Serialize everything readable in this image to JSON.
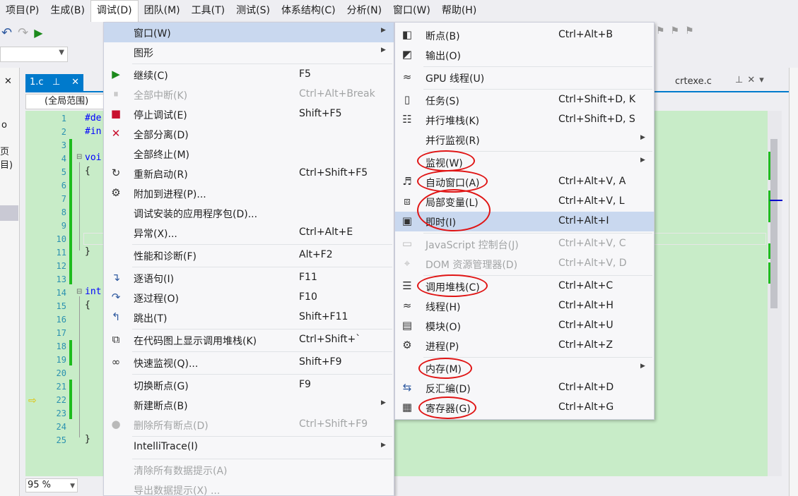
{
  "menubar": [
    "项目(P)",
    "生成(B)",
    "调试(D)",
    "团队(M)",
    "工具(T)",
    "测试(S)",
    "体系结构(C)",
    "分析(N)",
    "窗口(W)",
    "帮助(H)"
  ],
  "editor": {
    "tab_label": "1.c",
    "tab_pin": "⊥",
    "tab_close": "✕",
    "scope_label": "(全局范围)",
    "other_tab": "crtexe.c",
    "zoom": "95 %",
    "left_fragments": [
      "✕",
      "o",
      "页目)"
    ],
    "code_fragments": {
      "l1": "#de",
      "l2": "#in",
      "l4": "voi",
      "l5": "{",
      "l11": "}",
      "l14": "int",
      "l15": "{",
      "l25": "}"
    },
    "line_numbers": [
      "1",
      "2",
      "3",
      "4",
      "5",
      "6",
      "7",
      "8",
      "9",
      "10",
      "11",
      "12",
      "13",
      "14",
      "15",
      "16",
      "17",
      "18",
      "19",
      "20",
      "21",
      "22",
      "23",
      "24",
      "25"
    ]
  },
  "debug_menu": {
    "items": [
      {
        "label": "窗口(W)",
        "shortcut": "",
        "submenu": true,
        "icon": "none",
        "highlight": true
      },
      {
        "label": "图形",
        "shortcut": "",
        "submenu": true,
        "icon": "none"
      },
      {
        "label": "继续(C)",
        "shortcut": "F5",
        "icon": "play-icon"
      },
      {
        "label": "全部中断(K)",
        "shortcut": "Ctrl+Alt+Break",
        "icon": "pause-icon",
        "disabled": true
      },
      {
        "label": "停止调试(E)",
        "shortcut": "Shift+F5",
        "icon": "stop-icon"
      },
      {
        "label": "全部分离(D)",
        "shortcut": "",
        "icon": "detach-icon"
      },
      {
        "label": "全部终止(M)",
        "shortcut": "",
        "icon": "none"
      },
      {
        "label": "重新启动(R)",
        "shortcut": "Ctrl+Shift+F5",
        "icon": "restart-icon"
      },
      {
        "label": "附加到进程(P)...",
        "shortcut": "",
        "icon": "attach-icon"
      },
      {
        "label": "调试安装的应用程序包(D)...",
        "shortcut": "",
        "icon": "none"
      },
      {
        "label": "异常(X)...",
        "shortcut": "Ctrl+Alt+E",
        "icon": "none"
      },
      {
        "label": "性能和诊断(F)",
        "shortcut": "Alt+F2",
        "icon": "none"
      },
      {
        "label": "逐语句(I)",
        "shortcut": "F11",
        "icon": "step-into-icon"
      },
      {
        "label": "逐过程(O)",
        "shortcut": "F10",
        "icon": "step-over-icon"
      },
      {
        "label": "跳出(T)",
        "shortcut": "Shift+F11",
        "icon": "step-out-icon"
      },
      {
        "label": "在代码图上显示调用堆栈(K)",
        "shortcut": "Ctrl+Shift+`",
        "icon": "code-map-icon"
      },
      {
        "label": "快速监视(Q)...",
        "shortcut": "Shift+F9",
        "icon": "glasses-icon"
      },
      {
        "label": "切换断点(G)",
        "shortcut": "F9",
        "icon": "none"
      },
      {
        "label": "新建断点(B)",
        "shortcut": "",
        "submenu": true,
        "icon": "none"
      },
      {
        "label": "删除所有断点(D)",
        "shortcut": "Ctrl+Shift+F9",
        "icon": "delete-breakpoints-icon",
        "disabled": true
      },
      {
        "label": "IntelliTrace(I)",
        "shortcut": "",
        "submenu": true,
        "icon": "none"
      },
      {
        "label": "清除所有数据提示(A)",
        "shortcut": "",
        "icon": "none",
        "disabled": true
      },
      {
        "label": "导出数据提示(X) ...",
        "shortcut": "",
        "icon": "none",
        "disabled": true
      }
    ]
  },
  "window_submenu": {
    "items": [
      {
        "label": "断点(B)",
        "shortcut": "Ctrl+Alt+B",
        "icon": "breakpoints-icon"
      },
      {
        "label": "输出(O)",
        "shortcut": "",
        "icon": "output-icon"
      },
      {
        "label": "GPU 线程(U)",
        "shortcut": "",
        "icon": "gpu-threads-icon"
      },
      {
        "label": "任务(S)",
        "shortcut": "Ctrl+Shift+D, K",
        "icon": "tasks-icon"
      },
      {
        "label": "并行堆栈(K)",
        "shortcut": "Ctrl+Shift+D, S",
        "icon": "parallel-stacks-icon"
      },
      {
        "label": "并行监视(R)",
        "shortcut": "",
        "submenu": true,
        "icon": "none"
      },
      {
        "label": "监视(W)",
        "shortcut": "",
        "submenu": true,
        "icon": "none"
      },
      {
        "label": "自动窗口(A)",
        "shortcut": "Ctrl+Alt+V, A",
        "icon": "autos-icon"
      },
      {
        "label": "局部变量(L)",
        "shortcut": "Ctrl+Alt+V, L",
        "icon": "locals-icon"
      },
      {
        "label": "即时(I)",
        "shortcut": "Ctrl+Alt+I",
        "icon": "immediate-icon",
        "highlight": true
      },
      {
        "label": "JavaScript 控制台(J)",
        "shortcut": "Ctrl+Alt+V, C",
        "icon": "js-console-icon",
        "disabled": true
      },
      {
        "label": "DOM 资源管理器(D)",
        "shortcut": "Ctrl+Alt+V, D",
        "icon": "dom-explorer-icon",
        "disabled": true
      },
      {
        "label": "调用堆栈(C)",
        "shortcut": "Ctrl+Alt+C",
        "icon": "call-stack-icon"
      },
      {
        "label": "线程(H)",
        "shortcut": "Ctrl+Alt+H",
        "icon": "threads-icon"
      },
      {
        "label": "模块(O)",
        "shortcut": "Ctrl+Alt+U",
        "icon": "modules-icon"
      },
      {
        "label": "进程(P)",
        "shortcut": "Ctrl+Alt+Z",
        "icon": "processes-icon"
      },
      {
        "label": "内存(M)",
        "shortcut": "",
        "submenu": true,
        "icon": "none"
      },
      {
        "label": "反汇编(D)",
        "shortcut": "Ctrl+Alt+D",
        "icon": "disassembly-icon"
      },
      {
        "label": "寄存器(G)",
        "shortcut": "Ctrl+Alt+G",
        "icon": "registers-icon"
      }
    ]
  },
  "colors": {
    "accent": "#007acc",
    "highlight": "#c9d8ef",
    "annotation": "#e01515",
    "editor_bg": "#c8ecc8"
  }
}
